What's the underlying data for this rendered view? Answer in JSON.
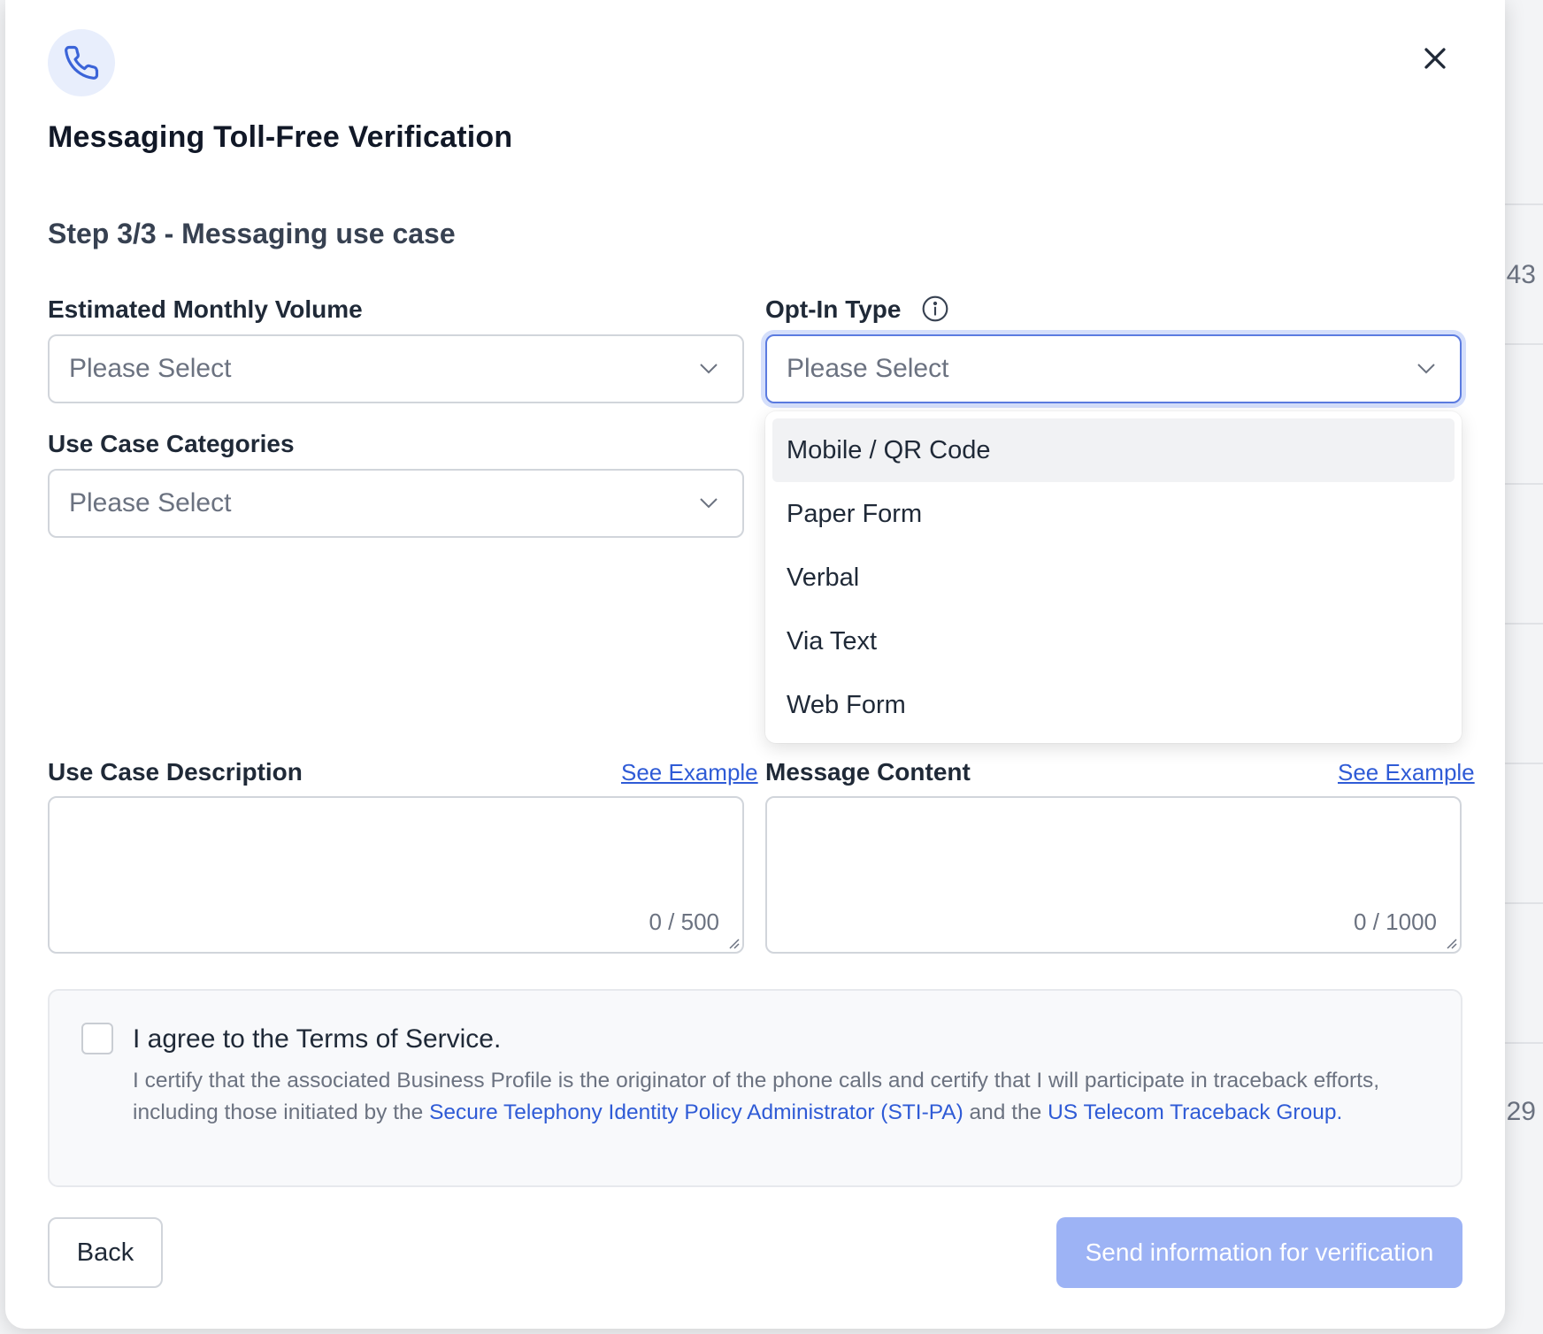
{
  "background": {
    "numbers": [
      "43",
      "29"
    ]
  },
  "modal": {
    "title": "Messaging Toll-Free Verification",
    "step": "Step 3/3 - Messaging use case",
    "header_icon": "phone-icon",
    "close_icon": "close-icon"
  },
  "form": {
    "monthly_volume": {
      "label": "Estimated Monthly Volume",
      "value": "Please Select"
    },
    "opt_in_type": {
      "label": "Opt-In Type",
      "value": "Please Select",
      "options": [
        "Mobile / QR Code",
        "Paper Form",
        "Verbal",
        "Via Text",
        "Web Form"
      ]
    },
    "use_case_categories": {
      "label": "Use Case Categories",
      "value": "Please Select"
    },
    "use_case_description": {
      "label": "Use Case Description",
      "example_link": "See Example",
      "counter": "0 / 500"
    },
    "message_content": {
      "label": "Message Content",
      "example_link": "See Example",
      "counter": "0 / 1000"
    }
  },
  "terms": {
    "title": "I agree to the Terms of Service.",
    "text_part1": "I certify that the associated Business Profile is the originator of the phone calls and certify that I will participate in traceback efforts, including those initiated by the ",
    "link1": "Secure Telephony Identity Policy Administrator (STI-PA)",
    "text_part2": " and the ",
    "link2": "US Telecom Traceback Group."
  },
  "buttons": {
    "back": "Back",
    "send": "Send information for verification"
  },
  "colors": {
    "accent": "#2f5bd6",
    "send_disabled": "#9db3f5",
    "focus_ring": "#5b7be0"
  }
}
